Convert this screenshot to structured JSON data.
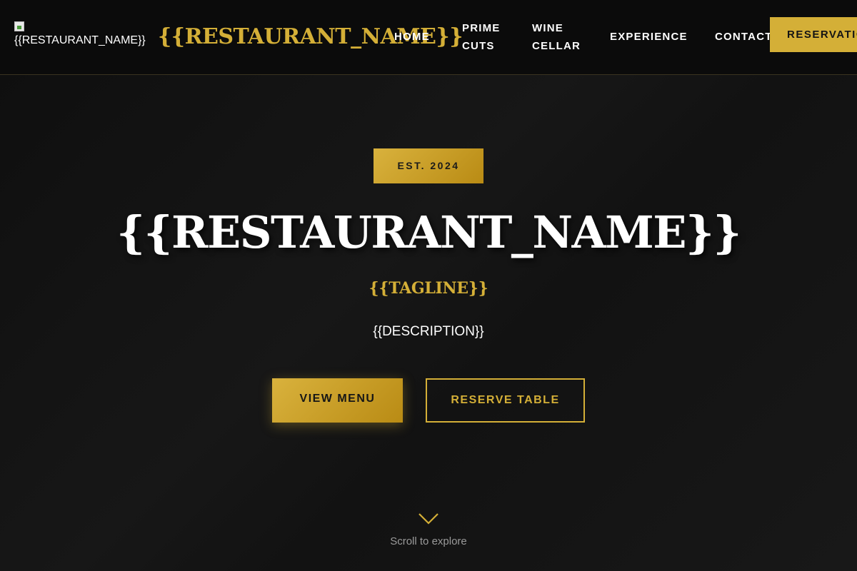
{
  "colors": {
    "accent": "#d4af37",
    "background": "#121212",
    "header_background": "#0b0b0b",
    "text": "#ffffff",
    "muted_text": "#9a9a9a"
  },
  "header": {
    "logo_alt": "{{RESTAURANT_NAME}}",
    "logo_icon": "broken-image-icon",
    "brand": "{{RESTAURANT_NAME}}",
    "nav": [
      {
        "label": "HOME"
      },
      {
        "label": "PRIME CUTS"
      },
      {
        "label": "WINE CELLAR"
      },
      {
        "label": "EXPERIENCE"
      },
      {
        "label": "CONTACT"
      }
    ],
    "cta_label": "RESERVATIONS"
  },
  "hero": {
    "badge": "EST. 2024",
    "title": "{{RESTAURANT_NAME}}",
    "tagline": "{{TAGLINE}}",
    "description": "{{DESCRIPTION}}",
    "primary_button": "VIEW MENU",
    "secondary_button": "RESERVE TABLE",
    "scroll_icon": "chevron-down-icon",
    "scroll_label": "Scroll to explore"
  }
}
